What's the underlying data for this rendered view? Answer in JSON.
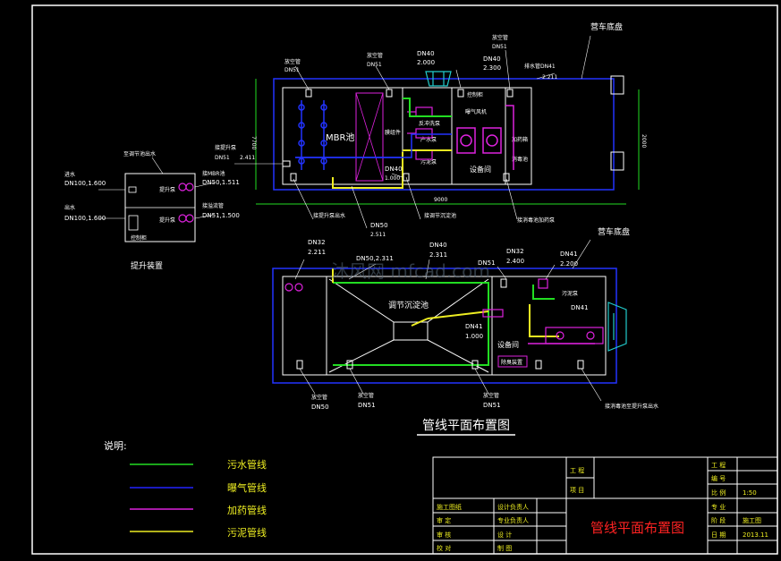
{
  "top_plan": {
    "mbr_tank": "MBR池",
    "equipment_room": "设备间",
    "disinfection_pool": "消毒池",
    "product_tank": "产水泵",
    "backwash_pump": "反冲洗泵",
    "aeration_fan": "曝气风机",
    "dosing_box": "加药箱",
    "sludge_pump": "污泥泵",
    "control_cabinet": "控制柜",
    "membrane_module": "膜组件",
    "vehicle_chassis": "营车底盘",
    "pipes": [
      {
        "name": "放空管",
        "dn": "DN51"
      },
      {
        "name": "放空管",
        "dn": "DN51"
      },
      {
        "name": "",
        "dn": "DN40",
        "elev": "2.000"
      },
      {
        "name": "放空管",
        "dn": "DN51"
      },
      {
        "name": "",
        "dn": "DN40",
        "elev": "2.300"
      },
      {
        "name": "排水管DN41",
        "dn": "",
        "elev": "2.211"
      },
      {
        "name": "接提升泵",
        "dn": "DN51",
        "elev": "2.411"
      },
      {
        "name": "",
        "dn": "DN40",
        "elev": "1.000"
      },
      {
        "name": "",
        "dn": "DN50",
        "elev": "2.511"
      }
    ],
    "labels_below": [
      "接提升泵出水",
      "接调节沉淀池",
      "接消毒池加药泵"
    ],
    "dim_left": "7700",
    "dim_right": "2000",
    "dim_bottom": "9000"
  },
  "lift_device": {
    "title": "提升装置",
    "labels": [
      {
        "text": "至调节池出水",
        "dn": ""
      },
      {
        "text": "进水",
        "dn": "DN100,1.600"
      },
      {
        "text": "出水",
        "dn": "DN100,1.600"
      },
      {
        "text": "接MBR池",
        "dn": "DN50,1.511"
      },
      {
        "text": "接溢流管",
        "dn": "DN51,1.500"
      }
    ],
    "pump_a": "提升泵",
    "pump_b": "提升泵",
    "control_box": "控制柜"
  },
  "bottom_plan": {
    "settling_tank": "调节沉淀池",
    "equipment_room": "设备间",
    "sludge_pump": "污泥泵",
    "dosing_device": "除臭装置",
    "vehicle_chassis": "营车底盘",
    "pipes": [
      {
        "dn": "DN32",
        "elev": "2.211"
      },
      {
        "dn": "DN50,2.311",
        "elev": ""
      },
      {
        "dn": "DN40",
        "elev": "2.311"
      },
      {
        "dn": "DN51",
        "elev": ""
      },
      {
        "dn": "DN32",
        "elev": "2.400"
      },
      {
        "dn": "DN41",
        "elev": "2.200"
      },
      {
        "dn": "DN41",
        "elev": "1.000"
      },
      {
        "dn": "DN41",
        "elev": ""
      },
      {
        "dn": "DN50",
        "elev": ""
      },
      {
        "dn": "DN51",
        "elev": ""
      },
      {
        "dn": "DN51",
        "elev": ""
      }
    ],
    "bottom_labels": [
      "放空管",
      "放空管",
      "放空管"
    ],
    "right_label": "接消毒池至提升泵出水"
  },
  "drawing_title": "管线平面布置图",
  "legend": {
    "title": "说明:",
    "items": [
      {
        "label": "污水管线",
        "color": "#22dd22"
      },
      {
        "label": "曝气管线",
        "color": "#2222ff"
      },
      {
        "label": "加药管线",
        "color": "#dd22dd"
      },
      {
        "label": "污泥管线",
        "color": "#eeee22"
      }
    ]
  },
  "title_block": {
    "project_label": "工 程",
    "project_sub": "项 目",
    "drawing_name": "管线平面布置图",
    "left_rows": [
      [
        "施工图纸",
        "设计负责人"
      ],
      [
        "审 定",
        "专业负责人"
      ],
      [
        "审 核",
        "设 计"
      ],
      [
        "校 对",
        "制 图"
      ]
    ],
    "right_rows": [
      [
        "工 程",
        ""
      ],
      [
        "编 号",
        ""
      ],
      [
        "比 例",
        "1:50"
      ],
      [
        "专 业",
        ""
      ],
      [
        "阶 段",
        "施工图"
      ],
      [
        "日 期",
        "2013.11"
      ]
    ]
  },
  "watermark": "沐风网 mfcad.com",
  "colors": {
    "line_white": "#ffffff",
    "blue_frame": "#2233ff",
    "green": "#22dd22",
    "magenta": "#dd22dd",
    "yellow": "#eeee22",
    "cyan": "#22cccc",
    "red": "#ff2222"
  }
}
